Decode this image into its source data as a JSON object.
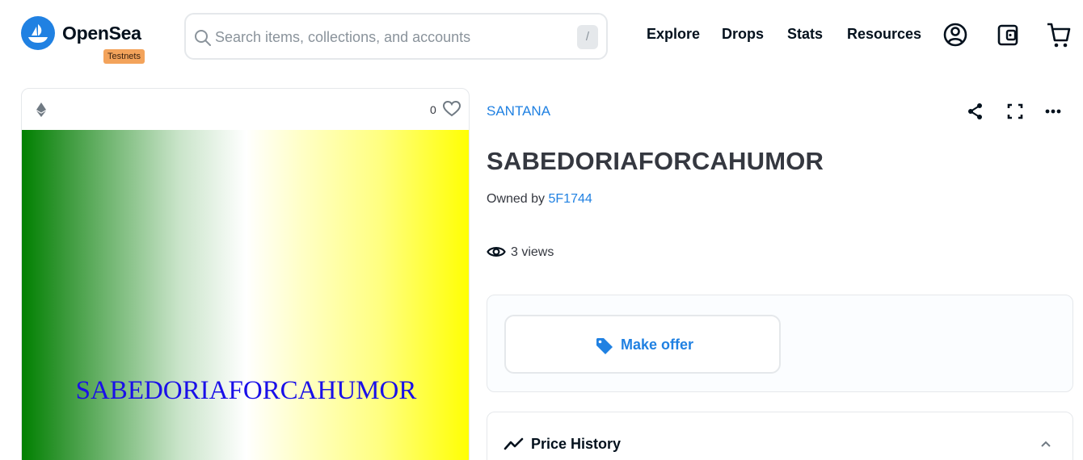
{
  "header": {
    "brand": "OpenSea",
    "network_badge": "Testnets",
    "search": {
      "placeholder": "Search items, collections, and accounts",
      "shortcut": "/"
    },
    "nav": [
      "Explore",
      "Drops",
      "Stats",
      "Resources"
    ],
    "icons": [
      "profile-icon",
      "wallet-icon",
      "cart-icon"
    ]
  },
  "item_card": {
    "chain_icon": "ethereum-icon",
    "favorites_count": "0",
    "artwork_text": "SABEDORIAFORCAHUMOR"
  },
  "item": {
    "collection": "SANTANA",
    "title": "SABEDORIAFORCAHUMOR",
    "owned_by_label": "Owned by",
    "owner": "5F1744",
    "views": "3 views",
    "actions": [
      "share-icon",
      "fullscreen-icon",
      "more-icon"
    ]
  },
  "offer": {
    "button_label": "Make offer"
  },
  "price_history": {
    "label": "Price History"
  },
  "colors": {
    "accent": "#2081e2",
    "badge": "#f3a35b",
    "artwork_text": "#1a10e8"
  }
}
